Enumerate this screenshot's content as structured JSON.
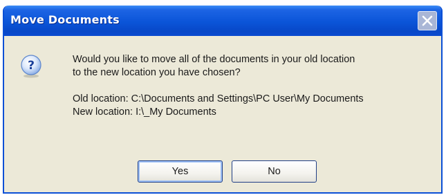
{
  "window": {
    "title": "Move Documents"
  },
  "message": {
    "question_line1": "Would you like to move all of the documents in your old location",
    "question_line2": "to the new location you have chosen?",
    "old_location": "Old location: C:\\Documents and Settings\\PC User\\My Documents",
    "new_location": "New location: I:\\_My Documents"
  },
  "buttons": {
    "yes_label": "Yes",
    "no_label": "No"
  },
  "icons": {
    "dialog_icon": "question-icon",
    "close_icon": "close-icon"
  },
  "colors": {
    "titlebar": "#0a54d8",
    "dialog_background": "#ece9d8",
    "title_text": "#ffffff"
  }
}
